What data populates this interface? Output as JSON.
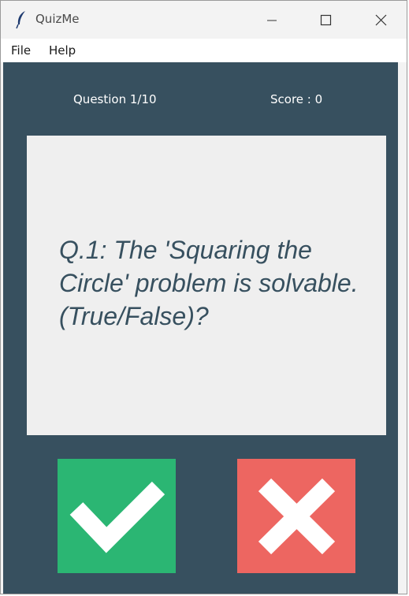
{
  "window": {
    "title": "QuizMe",
    "icon": "feather-icon"
  },
  "menu": {
    "items": [
      {
        "label": "File"
      },
      {
        "label": "Help"
      }
    ]
  },
  "quiz": {
    "question_counter": "Question 1/10",
    "score_text": "Score : 0",
    "question_text": "Q.1: The 'Squaring the Circle' problem is solvable. (True/False)?"
  },
  "buttons": {
    "true_icon": "checkmark-icon",
    "false_icon": "cross-icon"
  },
  "colors": {
    "background": "#37505f",
    "card": "#efefef",
    "true_button": "#2bb673",
    "false_button": "#ed6661",
    "question_text": "#37505f"
  }
}
